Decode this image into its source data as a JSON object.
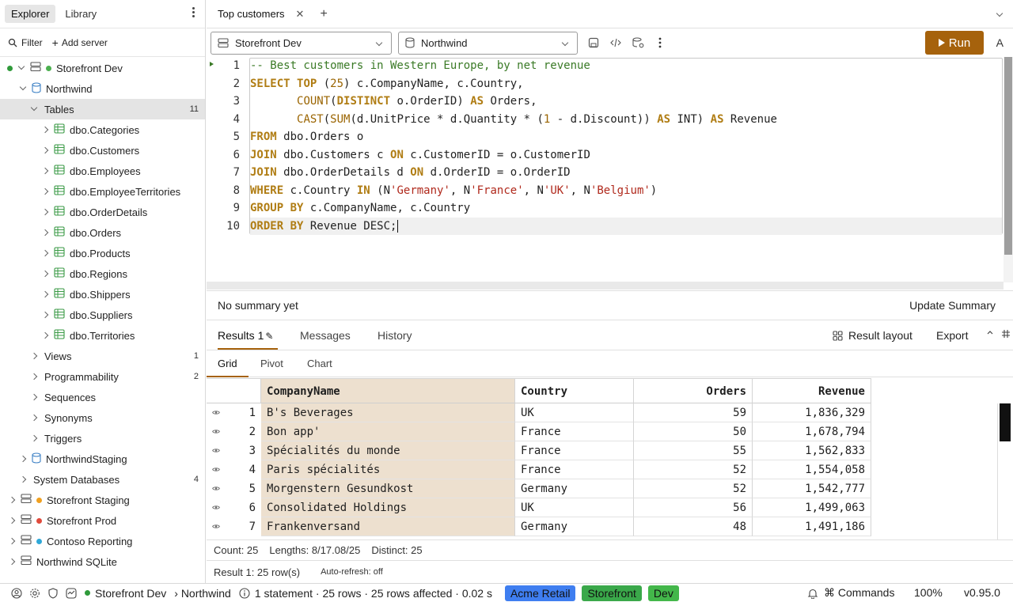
{
  "sidebar": {
    "tabs": [
      "Explorer",
      "Library"
    ],
    "filter_label": "Filter",
    "add_server_label": "Add server",
    "tree": {
      "server": "Storefront Dev",
      "database": "Northwind",
      "tables_label": "Tables",
      "tables_count": "11",
      "tables": [
        "dbo.Categories",
        "dbo.Customers",
        "dbo.Employees",
        "dbo.EmployeeTerritories",
        "dbo.OrderDetails",
        "dbo.Orders",
        "dbo.Products",
        "dbo.Regions",
        "dbo.Shippers",
        "dbo.Suppliers",
        "dbo.Territories"
      ],
      "views_label": "Views",
      "views_count": "1",
      "programmability_label": "Programmability",
      "programmability_count": "2",
      "sequences_label": "Sequences",
      "synonyms_label": "Synonyms",
      "triggers_label": "Triggers",
      "staging_db": "NorthwindStaging",
      "system_db_label": "System Databases",
      "system_db_count": "4",
      "other_servers": [
        {
          "name": "Storefront Staging",
          "color": "#f0a020"
        },
        {
          "name": "Storefront Prod",
          "color": "#e04a3c"
        },
        {
          "name": "Contoso Reporting",
          "color": "#2fa8d8"
        },
        {
          "name": "Northwind SQLite",
          "color": ""
        }
      ]
    }
  },
  "tabs": {
    "active_title": "Top customers"
  },
  "toolbar": {
    "server_select": "Storefront Dev",
    "database_select": "Northwind",
    "run_label": "Run",
    "a_label": "A"
  },
  "editor": {
    "line_numbers": [
      "1",
      "2",
      "3",
      "4",
      "5",
      "6",
      "7",
      "8",
      "9",
      "10"
    ]
  },
  "summary": {
    "text": "No summary yet",
    "update_label": "Update Summary"
  },
  "results": {
    "tabs": [
      "Results 1",
      "Messages",
      "History"
    ],
    "result_layout_label": "Result layout",
    "export_label": "Export",
    "view_tabs": [
      "Grid",
      "Pivot",
      "Chart"
    ],
    "columns": [
      "CompanyName",
      "Country",
      "Orders",
      "Revenue"
    ],
    "rows": [
      {
        "n": "1",
        "company": "B's Beverages",
        "country": "UK",
        "orders": "59",
        "revenue": "1,836,329"
      },
      {
        "n": "2",
        "company": "Bon app'",
        "country": "France",
        "orders": "50",
        "revenue": "1,678,794"
      },
      {
        "n": "3",
        "company": "Spécialités du monde",
        "country": "France",
        "orders": "55",
        "revenue": "1,562,833"
      },
      {
        "n": "4",
        "company": "Paris spécialités",
        "country": "France",
        "orders": "52",
        "revenue": "1,554,058"
      },
      {
        "n": "5",
        "company": "Morgenstern Gesundkost",
        "country": "Germany",
        "orders": "52",
        "revenue": "1,542,777"
      },
      {
        "n": "6",
        "company": "Consolidated Holdings",
        "country": "UK",
        "orders": "56",
        "revenue": "1,499,063"
      },
      {
        "n": "7",
        "company": "Frankenversand",
        "country": "Germany",
        "orders": "48",
        "revenue": "1,491,186"
      }
    ],
    "stats": {
      "count": "Count: 25",
      "lengths": "Lengths: 8/17.08/25",
      "distinct": "Distinct: 25"
    },
    "result_rows": "Result 1: 25 row(s)",
    "auto_refresh": "Auto-refresh: off"
  },
  "statusbar": {
    "server": "Storefront Dev",
    "database": "› Northwind",
    "message": "1 statement · 25 rows · 25 rows affected · 0.02 s",
    "pills": [
      {
        "label": "Acme Retail",
        "color": "#3f7ef0"
      },
      {
        "label": "Storefront",
        "color": "#3aa84a"
      },
      {
        "label": "Dev",
        "color": "#43b74a"
      }
    ],
    "commands_label": "Commands",
    "zoom": "100%",
    "version": "v0.95.0",
    "server_status_color": "#2f9a3a"
  }
}
